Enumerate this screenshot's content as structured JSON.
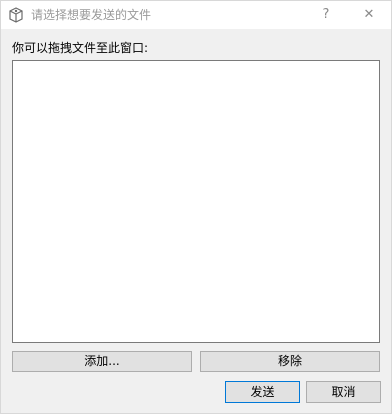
{
  "window": {
    "title": "请选择想要发送的文件",
    "help_glyph": "?",
    "close_glyph": "✕"
  },
  "prompt": {
    "label": "你可以拖拽文件至此窗口:"
  },
  "file_list": {
    "items": []
  },
  "buttons": {
    "add_label": "添加...",
    "remove_label": "移除",
    "send_label": "发送",
    "cancel_label": "取消"
  },
  "colors": {
    "accent": "#0078d7",
    "dialog_background": "#f0f0f0",
    "button_face": "#e1e1e1"
  },
  "icons": {
    "app_icon": "package-icon",
    "help_icon": "question-mark-icon",
    "close_icon": "close-icon"
  }
}
